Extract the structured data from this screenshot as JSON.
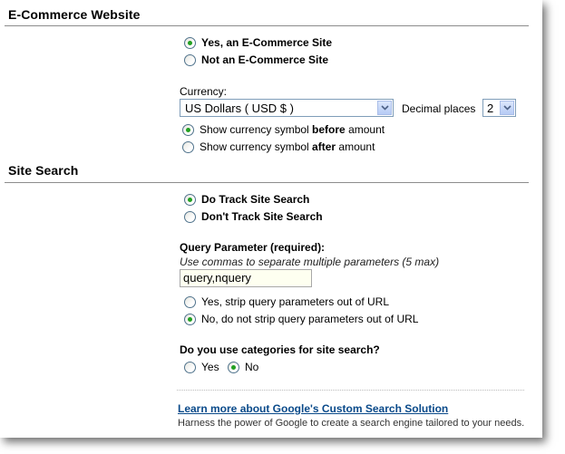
{
  "ecommerce": {
    "header": "E-Commerce Website",
    "option_yes": "Yes, an E-Commerce Site",
    "option_no": "Not an E-Commerce Site",
    "currency_label": "Currency:",
    "currency_value": "US Dollars ( USD $ )",
    "decimal_label": "Decimal places",
    "decimal_value": "2",
    "symbol_before_pre": "Show currency symbol ",
    "symbol_before_bold": "before",
    "symbol_before_post": " amount",
    "symbol_after_pre": "Show currency symbol ",
    "symbol_after_bold": "after",
    "symbol_after_post": " amount"
  },
  "site_search": {
    "header": "Site Search",
    "option_track": "Do Track Site Search",
    "option_no_track": "Don't Track Site Search",
    "query_label": "Query Parameter (required):",
    "query_hint": "Use commas to separate multiple parameters (5 max)",
    "query_value": "query,nquery",
    "strip_yes": "Yes, strip query parameters out of URL",
    "strip_no": "No, do not strip query parameters out of URL",
    "categories_question": "Do you use categories for site search?",
    "categories_yes": "Yes",
    "categories_no": "No",
    "learn_more": "Learn more about Google's Custom Search Solution",
    "learn_more_desc": "Harness the power of Google to create a search engine tailored to your needs."
  },
  "selected": {
    "ecommerce": "yes",
    "symbol": "before",
    "tracking": "track",
    "strip": "no",
    "categories": "no"
  },
  "colors": {
    "accent_green": "#22a022",
    "link": "#0a4a8a",
    "rule": "#8c8c8c"
  }
}
